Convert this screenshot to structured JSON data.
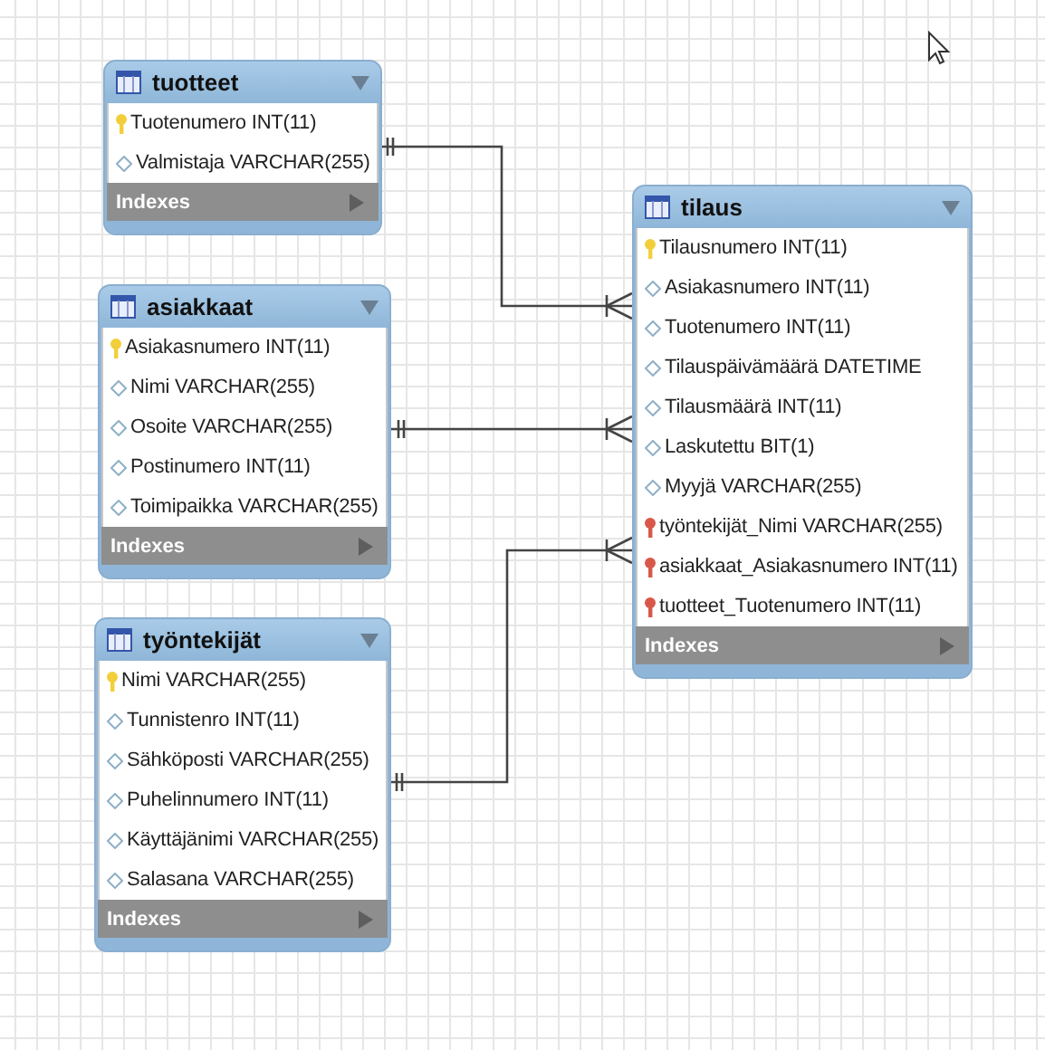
{
  "tables": [
    {
      "name": "tuotteet",
      "columns": [
        {
          "text": "Tuotenumero INT(11)",
          "kind": "pk"
        },
        {
          "text": "Valmistaja VARCHAR(255)",
          "kind": "column"
        }
      ],
      "indexes": "Indexes"
    },
    {
      "name": "asiakkaat",
      "columns": [
        {
          "text": "Asiakasnumero INT(11)",
          "kind": "pk"
        },
        {
          "text": "Nimi VARCHAR(255)",
          "kind": "column"
        },
        {
          "text": "Osoite VARCHAR(255)",
          "kind": "column"
        },
        {
          "text": "Postinumero INT(11)",
          "kind": "column"
        },
        {
          "text": "Toimipaikka VARCHAR(255)",
          "kind": "column"
        }
      ],
      "indexes": "Indexes"
    },
    {
      "name": "työntekijät",
      "columns": [
        {
          "text": "Nimi VARCHAR(255)",
          "kind": "pk"
        },
        {
          "text": "Tunnistenro INT(11)",
          "kind": "column"
        },
        {
          "text": "Sähköposti VARCHAR(255)",
          "kind": "column"
        },
        {
          "text": "Puhelinnumero INT(11)",
          "kind": "column"
        },
        {
          "text": "Käyttäjänimi VARCHAR(255)",
          "kind": "column"
        },
        {
          "text": "Salasana VARCHAR(255)",
          "kind": "column"
        }
      ],
      "indexes": "Indexes"
    },
    {
      "name": "tilaus",
      "columns": [
        {
          "text": "Tilausnumero INT(11)",
          "kind": "pk"
        },
        {
          "text": "Asiakasnumero INT(11)",
          "kind": "column"
        },
        {
          "text": "Tuotenumero INT(11)",
          "kind": "column"
        },
        {
          "text": "Tilauspäivämäärä DATETIME",
          "kind": "column"
        },
        {
          "text": "Tilausmäärä INT(11)",
          "kind": "column"
        },
        {
          "text": "Laskutettu BIT(1)",
          "kind": "column"
        },
        {
          "text": "Myyjä VARCHAR(255)",
          "kind": "column"
        },
        {
          "text": "työntekijät_Nimi VARCHAR(255)",
          "kind": "fk"
        },
        {
          "text": "asiakkaat_Asiakasnumero INT(11)",
          "kind": "fk"
        },
        {
          "text": "tuotteet_Tuotenumero INT(11)",
          "kind": "fk"
        }
      ],
      "indexes": "Indexes"
    }
  ]
}
